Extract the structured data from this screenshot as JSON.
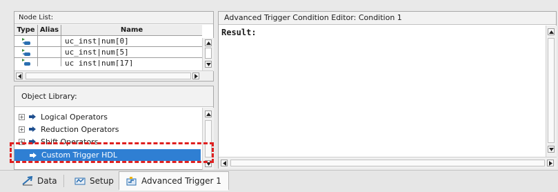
{
  "node_list": {
    "title": "Node List:",
    "columns": [
      "Type",
      "Alias",
      "Name"
    ],
    "rows": [
      {
        "alias": "",
        "name": "uc_inst|num[0]"
      },
      {
        "alias": "",
        "name": "uc_inst|num[5]"
      },
      {
        "alias": "",
        "name": "uc_inst|num[17]"
      }
    ]
  },
  "object_library": {
    "title": "Object Library:",
    "items": [
      {
        "label": "Logical Operators",
        "expander": "+"
      },
      {
        "label": "Reduction Operators",
        "expander": "+"
      },
      {
        "label": "Shift Operators",
        "expander": "+"
      },
      {
        "label": "Custom Trigger HDL",
        "selected": true
      }
    ]
  },
  "editor": {
    "title": "Advanced Trigger Condition Editor: Condition 1",
    "content": "Result:"
  },
  "tabs": [
    {
      "label": "Data",
      "icon": "data-icon"
    },
    {
      "label": "Setup",
      "icon": "setup-icon"
    },
    {
      "label": "Advanced Trigger 1",
      "icon": "advanced-trigger-icon",
      "active": true
    }
  ],
  "colors": {
    "selection": "#2f7fd3",
    "highlight_border": "#e02020",
    "node_icon": "#2a6fb0"
  }
}
